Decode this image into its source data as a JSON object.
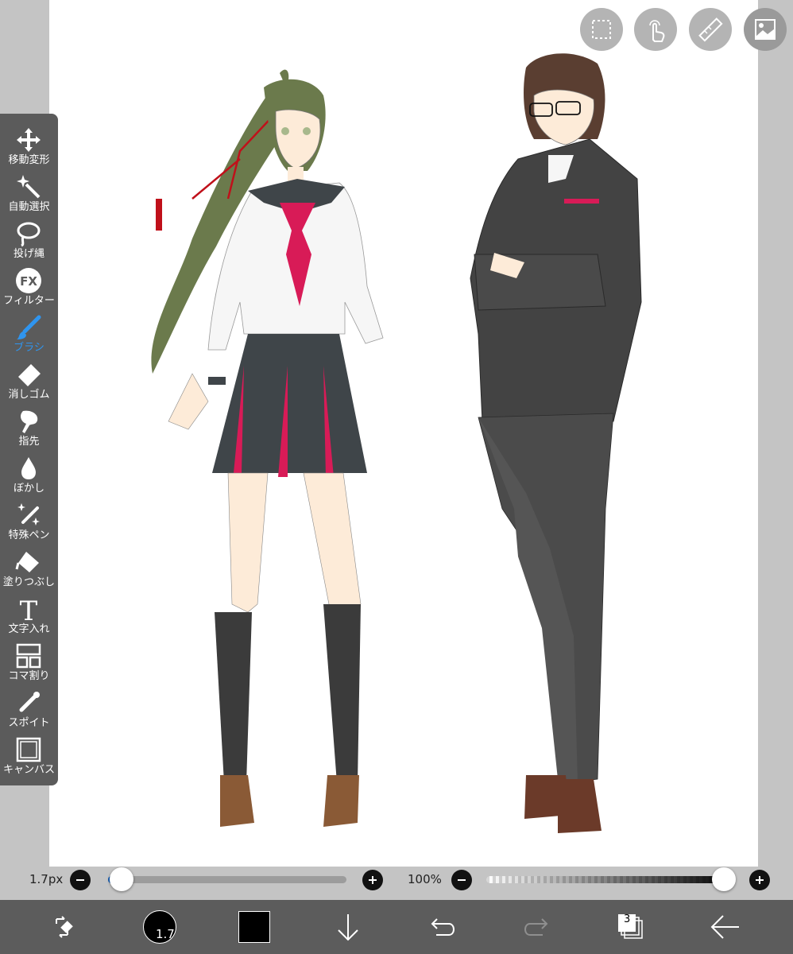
{
  "toolbar": {
    "items": [
      {
        "label": "移動変形",
        "icon": "move-icon"
      },
      {
        "label": "自動選択",
        "icon": "magic-wand-icon"
      },
      {
        "label": "投げ縄",
        "icon": "lasso-icon"
      },
      {
        "label": "フィルター",
        "icon": "fx-icon",
        "icon_text": "FX"
      },
      {
        "label": "ブラシ",
        "icon": "brush-icon",
        "active": true
      },
      {
        "label": "消しゴム",
        "icon": "eraser-icon"
      },
      {
        "label": "指先",
        "icon": "finger-icon"
      },
      {
        "label": "ぼかし",
        "icon": "blur-drop-icon"
      },
      {
        "label": "特殊ペン",
        "icon": "special-pen-icon"
      },
      {
        "label": "塗りつぶし",
        "icon": "fill-bucket-icon"
      },
      {
        "label": "文字入れ",
        "icon": "text-icon",
        "icon_text": "T"
      },
      {
        "label": "コマ割り",
        "icon": "frame-divider-icon"
      },
      {
        "label": "スポイト",
        "icon": "eyedropper-icon"
      },
      {
        "label": "キャンバス",
        "icon": "canvas-icon"
      }
    ]
  },
  "top_buttons": [
    "selection-icon",
    "touch-gesture-icon",
    "ruler-icon",
    "material-image-icon"
  ],
  "sliders": {
    "brush_size_label": "1.7px",
    "brush_size_fraction": 0.0,
    "opacity_label": "100%",
    "opacity_fraction": 1.0
  },
  "bottom_bar": {
    "brush_size_text": "1.7",
    "current_color": "#000000",
    "layer_count": "3",
    "icons": [
      "transform-toggle-icon",
      "brush-size-icon",
      "color-swatch",
      "download-arrow-icon",
      "undo-icon",
      "redo-icon",
      "layers-icon",
      "back-arrow-icon"
    ]
  },
  "colors": {
    "accent": "#2f95ef",
    "toolbar_bg": "#5b5b5b",
    "bottom_bar_bg": "#5c5c5c",
    "canvas_bg": "#ffffff",
    "outer_bg": "#c4c4c4"
  }
}
